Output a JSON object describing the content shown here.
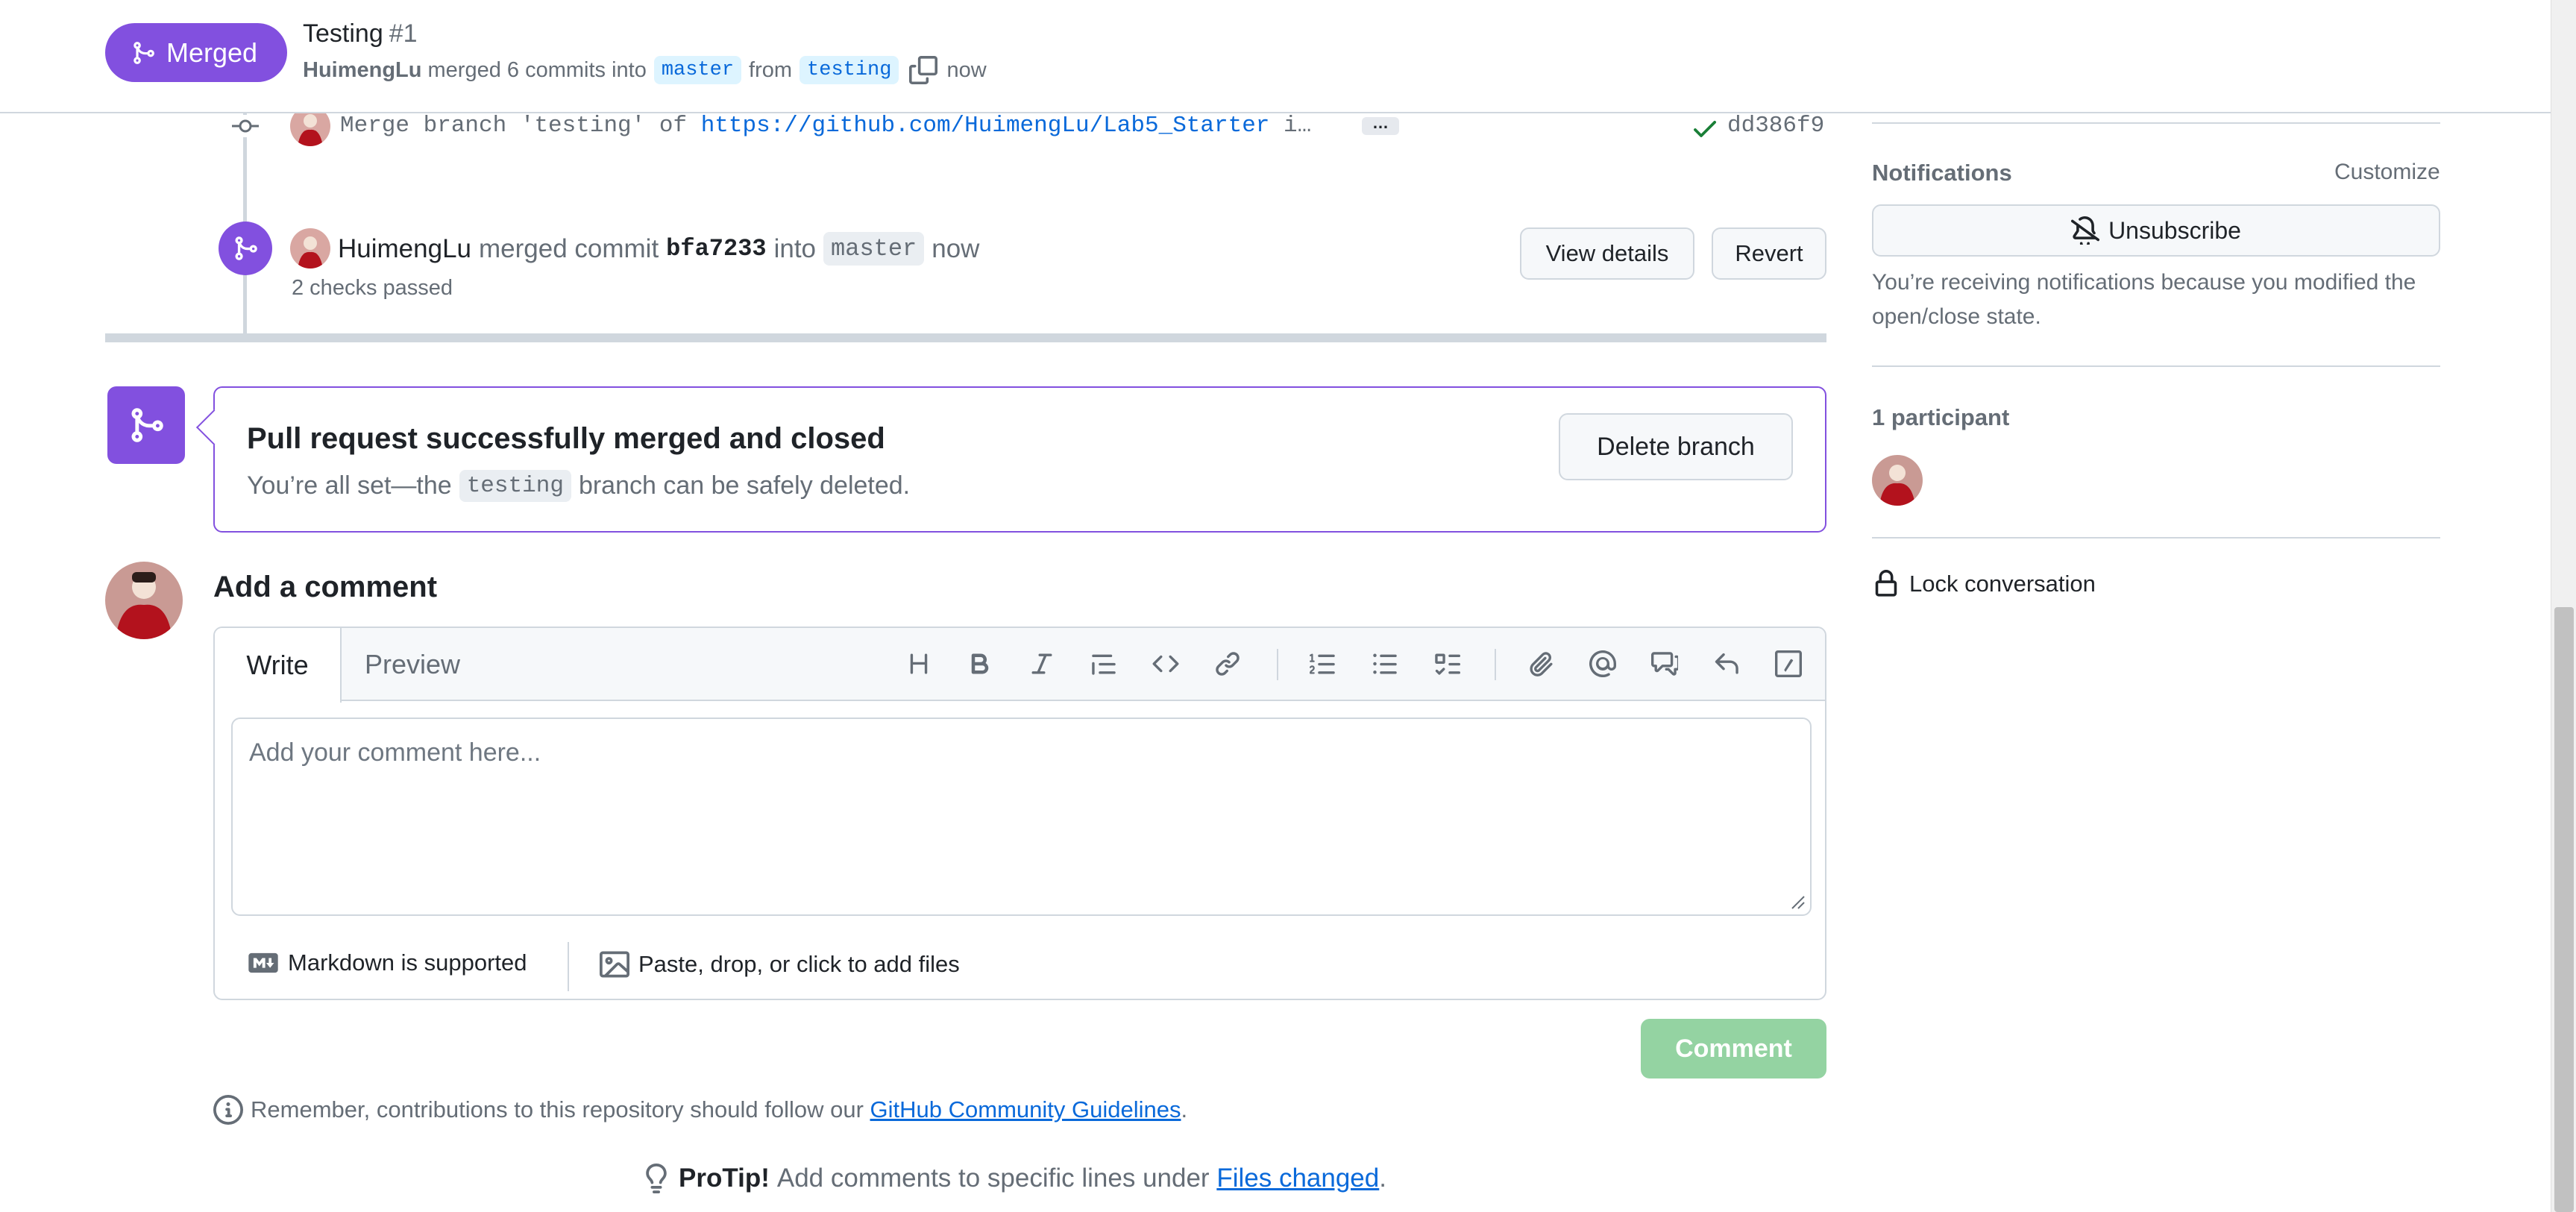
{
  "header": {
    "status_label": "Merged",
    "title": "Testing",
    "number": "#1",
    "author": "HuimengLu",
    "merged_text": "merged 6 commits into",
    "base_branch": "master",
    "from_text": "from",
    "head_branch": "testing",
    "time": "now"
  },
  "timeline": {
    "commit": {
      "message_prefix": "Merge branch 'testing' of",
      "link": "https://github.com/HuimengLu/Lab5_Starter",
      "message_suffix": "i…",
      "ellipsis": "…",
      "sha": "dd386f9"
    },
    "merge_event": {
      "author": "HuimengLu",
      "action": "merged commit",
      "sha": "bfa7233",
      "into_text": "into",
      "branch": "master",
      "time": "now",
      "checks": "2 checks passed",
      "view_details_label": "View details",
      "revert_label": "Revert"
    }
  },
  "merged_box": {
    "title": "Pull request successfully merged and closed",
    "sub_prefix": "You’re all set—the",
    "branch": "testing",
    "sub_suffix": "branch can be safely deleted.",
    "delete_label": "Delete branch"
  },
  "comment": {
    "title": "Add a comment",
    "tab_write": "Write",
    "tab_preview": "Preview",
    "placeholder": "Add your comment here...",
    "markdown_label": "Markdown is supported",
    "attach_label": "Paste, drop, or click to add files",
    "submit_label": "Comment",
    "guidelines_prefix": "Remember, contributions to this repository should follow our",
    "guidelines_link": "GitHub Community Guidelines",
    "guidelines_suffix": ".",
    "protip_bold": "ProTip!",
    "protip_text": "Add comments to specific lines under",
    "protip_link": "Files changed",
    "protip_suffix": "."
  },
  "toolbar_icons": [
    "heading-icon",
    "bold-icon",
    "italic-icon",
    "quote-icon",
    "code-icon",
    "link-icon",
    "ordered-list-icon",
    "unordered-list-icon",
    "task-list-icon",
    "attach-icon",
    "mention-icon",
    "cross-reference-icon",
    "saved-reply-icon",
    "slash-command-icon"
  ],
  "sidebar": {
    "notifications_heading": "Notifications",
    "customize_label": "Customize",
    "unsubscribe_label": "Unsubscribe",
    "notifications_text": "You’re receiving notifications because you modified the open/close state.",
    "participants_heading": "1 participant",
    "lock_label": "Lock conversation"
  },
  "colors": {
    "merged_purple": "#8250df",
    "link_blue": "#0969da",
    "comment_button_disabled": "#94d3a2",
    "check_green": "#1a7f37"
  }
}
